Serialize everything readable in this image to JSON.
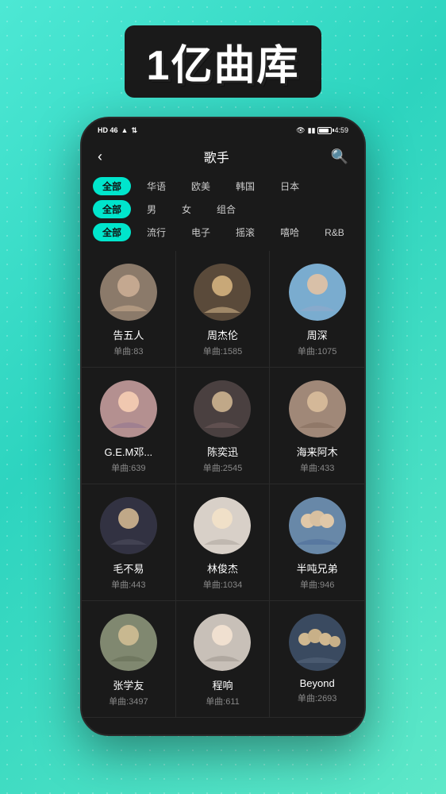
{
  "header": {
    "title": "1亿曲库"
  },
  "statusBar": {
    "left": "HD 46",
    "time": "4:59",
    "battery": "70"
  },
  "navBar": {
    "title": "歌手",
    "back": "‹",
    "search": "🔍"
  },
  "filters": {
    "row1": {
      "items": [
        {
          "label": "全部",
          "active": true
        },
        {
          "label": "华语",
          "active": false
        },
        {
          "label": "欧美",
          "active": false
        },
        {
          "label": "韩国",
          "active": false
        },
        {
          "label": "日本",
          "active": false
        }
      ]
    },
    "row2": {
      "items": [
        {
          "label": "全部",
          "active": true
        },
        {
          "label": "男",
          "active": false
        },
        {
          "label": "女",
          "active": false
        },
        {
          "label": "组合",
          "active": false
        }
      ]
    },
    "row3": {
      "items": [
        {
          "label": "全部",
          "active": true
        },
        {
          "label": "流行",
          "active": false
        },
        {
          "label": "电子",
          "active": false
        },
        {
          "label": "摇滚",
          "active": false
        },
        {
          "label": "嘻哈",
          "active": false
        },
        {
          "label": "R&B",
          "active": false
        }
      ]
    }
  },
  "artists": [
    {
      "name": "告五人",
      "count": "单曲:83",
      "avatar": "av-1",
      "emoji": "🎵"
    },
    {
      "name": "周杰伦",
      "count": "单曲:1585",
      "avatar": "av-2",
      "emoji": "🎤"
    },
    {
      "name": "周深",
      "count": "单曲:1075",
      "avatar": "av-3",
      "emoji": "🎶"
    },
    {
      "name": "G.E.M邓...",
      "count": "单曲:639",
      "avatar": "av-4",
      "emoji": "🎸"
    },
    {
      "name": "陈奕迅",
      "count": "单曲:2545",
      "avatar": "av-5",
      "emoji": "🎹"
    },
    {
      "name": "海来阿木",
      "count": "单曲:433",
      "avatar": "av-6",
      "emoji": "🎼"
    },
    {
      "name": "毛不易",
      "count": "单曲:443",
      "avatar": "av-7",
      "emoji": "🎧"
    },
    {
      "name": "林俊杰",
      "count": "单曲:1034",
      "avatar": "av-8",
      "emoji": "🎺"
    },
    {
      "name": "半吨兄弟",
      "count": "单曲:946",
      "avatar": "av-9",
      "emoji": "🥁"
    },
    {
      "name": "张学友",
      "count": "单曲:3497",
      "avatar": "av-10",
      "emoji": "🎻"
    },
    {
      "name": "程响",
      "count": "单曲:611",
      "avatar": "av-11",
      "emoji": "🎙"
    },
    {
      "name": "Beyond",
      "count": "单曲:2693",
      "avatar": "av-12",
      "emoji": "🎤"
    }
  ]
}
